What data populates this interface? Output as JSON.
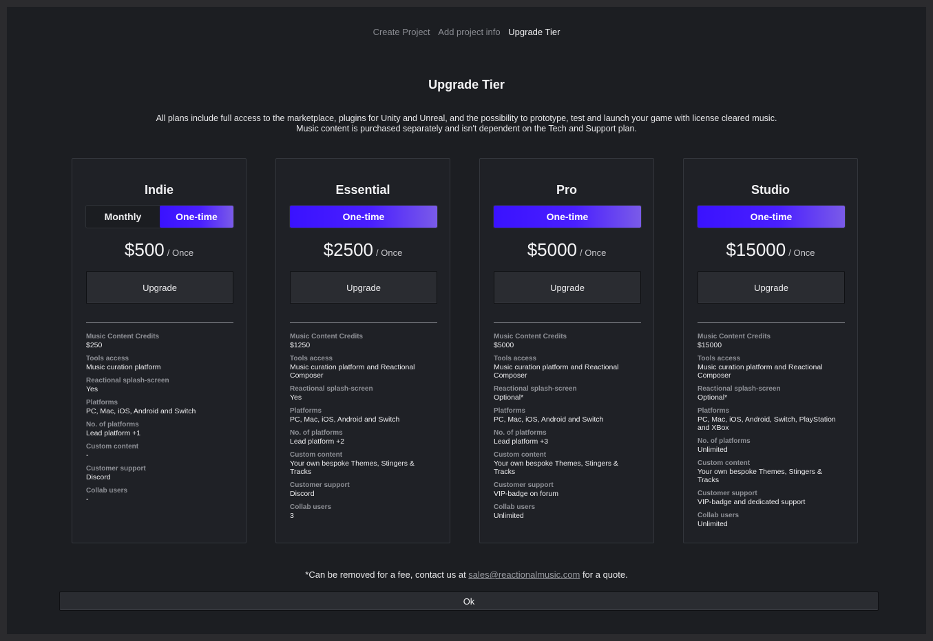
{
  "breadcrumb": [
    "Create Project",
    "Add project info",
    "Upgrade Tier"
  ],
  "title": "Upgrade Tier",
  "intro": [
    "All plans include full access to the marketplace, plugins for Unity and Unreal, and the possibility to prototype, test and launch your game with license cleared music.",
    "Music content is purchased separately and isn't dependent on the Tech and Support plan."
  ],
  "colors": {
    "accent_start": "#3a12ff",
    "accent_end": "#7a5be8",
    "background": "#1c1e22",
    "card": "#1f2126"
  },
  "plans": [
    {
      "name": "Indie",
      "options": [
        {
          "label": "Monthly",
          "selected": false
        },
        {
          "label": "One-time",
          "selected": true
        }
      ],
      "price": "$500",
      "period": "/ Once",
      "button": "Upgrade",
      "features": [
        {
          "label": "Music Content Credits",
          "value": "$250"
        },
        {
          "label": "Tools access",
          "value": "Music curation platform"
        },
        {
          "label": "Reactional splash-screen",
          "value": "Yes"
        },
        {
          "label": "Platforms",
          "value": "PC, Mac, iOS, Android and Switch"
        },
        {
          "label": "No. of platforms",
          "value": "Lead platform +1"
        },
        {
          "label": "Custom content",
          "value": "-"
        },
        {
          "label": "Customer support",
          "value": "Discord"
        },
        {
          "label": "Collab users",
          "value": "-"
        }
      ]
    },
    {
      "name": "Essential",
      "options": [
        {
          "label": "One-time",
          "selected": true
        }
      ],
      "price": "$2500",
      "period": "/ Once",
      "button": "Upgrade",
      "features": [
        {
          "label": "Music Content Credits",
          "value": "$1250"
        },
        {
          "label": "Tools access",
          "value": "Music curation platform and Reactional Composer"
        },
        {
          "label": "Reactional splash-screen",
          "value": "Yes"
        },
        {
          "label": "Platforms",
          "value": "PC, Mac, iOS, Android and Switch"
        },
        {
          "label": "No. of platforms",
          "value": "Lead platform +2"
        },
        {
          "label": "Custom content",
          "value": "Your own bespoke Themes, Stingers & Tracks"
        },
        {
          "label": "Customer support",
          "value": "Discord"
        },
        {
          "label": "Collab users",
          "value": "3"
        }
      ]
    },
    {
      "name": "Pro",
      "options": [
        {
          "label": "One-time",
          "selected": true
        }
      ],
      "price": "$5000",
      "period": "/ Once",
      "button": "Upgrade",
      "features": [
        {
          "label": "Music Content Credits",
          "value": "$5000"
        },
        {
          "label": "Tools access",
          "value": "Music curation platform and Reactional Composer"
        },
        {
          "label": "Reactional splash-screen",
          "value": "Optional*"
        },
        {
          "label": "Platforms",
          "value": "PC, Mac, iOS, Android and Switch"
        },
        {
          "label": "No. of platforms",
          "value": "Lead platform +3"
        },
        {
          "label": "Custom content",
          "value": "Your own bespoke Themes, Stingers & Tracks"
        },
        {
          "label": "Customer support",
          "value": "VIP-badge on forum"
        },
        {
          "label": "Collab users",
          "value": "Unlimited"
        }
      ]
    },
    {
      "name": "Studio",
      "options": [
        {
          "label": "One-time",
          "selected": true
        }
      ],
      "price": "$15000",
      "period": "/ Once",
      "button": "Upgrade",
      "features": [
        {
          "label": "Music Content Credits",
          "value": "$15000"
        },
        {
          "label": "Tools access",
          "value": "Music curation platform and Reactional Composer"
        },
        {
          "label": "Reactional splash-screen",
          "value": "Optional*"
        },
        {
          "label": "Platforms",
          "value": "PC, Mac, iOS, Android, Switch, PlayStation and XBox"
        },
        {
          "label": "No. of platforms",
          "value": "Unlimited"
        },
        {
          "label": "Custom content",
          "value": "Your own bespoke Themes, Stingers & Tracks"
        },
        {
          "label": "Customer support",
          "value": "VIP-badge and dedicated support"
        },
        {
          "label": "Collab users",
          "value": "Unlimited"
        }
      ]
    }
  ],
  "footnote": {
    "before": "*Can be removed for a fee, contact us at ",
    "email": "sales@reactionalmusic.com",
    "after": " for a quote."
  },
  "ok_label": "Ok"
}
